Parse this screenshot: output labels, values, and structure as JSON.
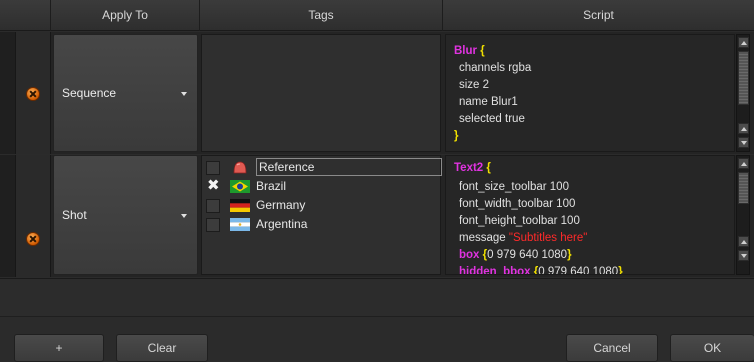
{
  "columns": {
    "apply_to": "Apply To",
    "tags": "Tags",
    "script": "Script"
  },
  "rows": [
    {
      "apply_to": "Sequence",
      "script": {
        "lines": [
          [
            {
              "t": "Blur ",
              "c": "pink"
            },
            {
              "t": "{",
              "c": "yel"
            }
          ],
          [
            {
              "t": "channels rgba",
              "c": ""
            }
          ],
          [
            {
              "t": "size 2",
              "c": ""
            }
          ],
          [
            {
              "t": "name Blur1",
              "c": ""
            }
          ],
          [
            {
              "t": "selected true",
              "c": ""
            }
          ],
          [
            {
              "t": "}",
              "c": "yel"
            }
          ]
        ]
      }
    },
    {
      "apply_to": "Shot",
      "tags": [
        {
          "name": "Reference",
          "icon": "reference-icon",
          "checked": false,
          "selected": true
        },
        {
          "name": "Brazil",
          "icon": "brazil-flag-icon",
          "checked": true,
          "selected": false
        },
        {
          "name": "Germany",
          "icon": "germany-flag-icon",
          "checked": false,
          "selected": false
        },
        {
          "name": "Argentina",
          "icon": "argentina-flag-icon",
          "checked": false,
          "selected": false
        }
      ],
      "check_mark": "✖",
      "script": {
        "lines": [
          [
            {
              "t": "Text2 ",
              "c": "pink"
            },
            {
              "t": "{",
              "c": "yel"
            }
          ],
          [
            {
              "t": "font_size_toolbar 100",
              "c": ""
            }
          ],
          [
            {
              "t": "font_width_toolbar 100",
              "c": ""
            }
          ],
          [
            {
              "t": "font_height_toolbar 100",
              "c": ""
            }
          ],
          [
            {
              "t": "message ",
              "c": ""
            },
            {
              "t": "\"Subtitles here\"",
              "c": "red"
            }
          ],
          [
            {
              "t": "box ",
              "c": "pink"
            },
            {
              "t": "{",
              "c": "yel"
            },
            {
              "t": "0 979 640 1080",
              "c": ""
            },
            {
              "t": "}",
              "c": "yel"
            }
          ],
          [
            {
              "t": "hidden_bbox ",
              "c": "pink"
            },
            {
              "t": "{",
              "c": "yel"
            },
            {
              "t": "0 979 640 1080",
              "c": ""
            },
            {
              "t": "}",
              "c": "yel"
            }
          ]
        ]
      }
    }
  ],
  "buttons": {
    "add": "+",
    "clear": "Clear",
    "cancel": "Cancel",
    "ok": "OK"
  },
  "colors": {
    "keyword": "#e033e0",
    "brace": "#f0e000",
    "string": "#ff2a2a",
    "remove_icon": "#f07a10"
  }
}
